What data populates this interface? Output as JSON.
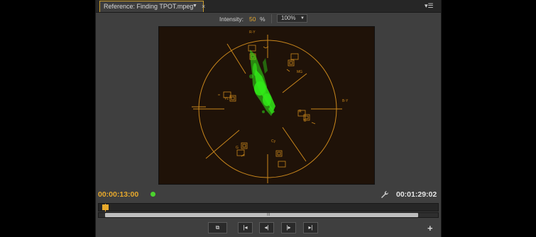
{
  "panel": {
    "tab_title": "Reference: Finding TPOT.mpeg",
    "tab_dropdown_icon": "dropdown-arrow-icon",
    "tab_close": "×",
    "panel_menu": "▾☰"
  },
  "controls": {
    "intensity_label": "Intensity:",
    "intensity_value": "50",
    "intensity_unit": "%",
    "zoom_value": "100%"
  },
  "vectorscope": {
    "labels": {
      "ry": "R-Y",
      "by": "B-Y",
      "r": "R",
      "mg": "MG",
      "b": "B",
      "cy": "Cy",
      "g": "G",
      "yl": "YL"
    },
    "trace_color": "#33ff1a",
    "graticule_color": "#c8861c"
  },
  "timeline": {
    "current_timecode": "00:00:13:00",
    "duration_timecode": "00:01:29:02",
    "status_dot_color": "#4bd32e",
    "playhead_fraction": 0.0,
    "scroll_grip": "III"
  },
  "transport": {
    "toggle_label": "⧉",
    "go_in_label": "|◂",
    "step_back_label": "◂|",
    "step_forward_label": "|▸",
    "go_out_label": "▸|",
    "add_label": "+"
  }
}
